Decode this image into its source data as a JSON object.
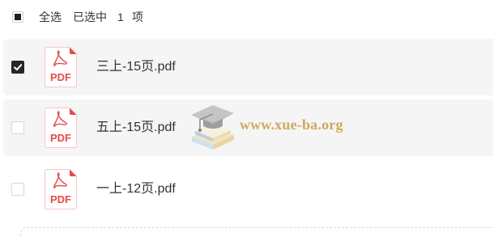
{
  "toolbar": {
    "select_all_state": "indeterminate",
    "select_all_label": "全选",
    "selected_prefix": "已选中",
    "selected_count": "1",
    "selected_suffix": "项"
  },
  "files": [
    {
      "name": "三上-15页.pdf",
      "type_label": "PDF",
      "icon": "pdf-file-icon",
      "checked": true,
      "highlighted": true
    },
    {
      "name": "五上-15页.pdf",
      "type_label": "PDF",
      "icon": "pdf-file-icon",
      "checked": false,
      "highlighted": true
    },
    {
      "name": "一上-12页.pdf",
      "type_label": "PDF",
      "icon": "pdf-file-icon",
      "checked": false,
      "highlighted": false
    }
  ],
  "watermark": {
    "logo": "graduation-cap-logo",
    "text": "www.xue-ba.org"
  },
  "colors": {
    "checkbox_checked": "#262626",
    "row_highlight": "#f5f5f5",
    "pdf_red": "#e34d4d",
    "watermark_gold": "#c9a14f",
    "text": "#333333",
    "dashed_border": "#d9d9d9"
  }
}
